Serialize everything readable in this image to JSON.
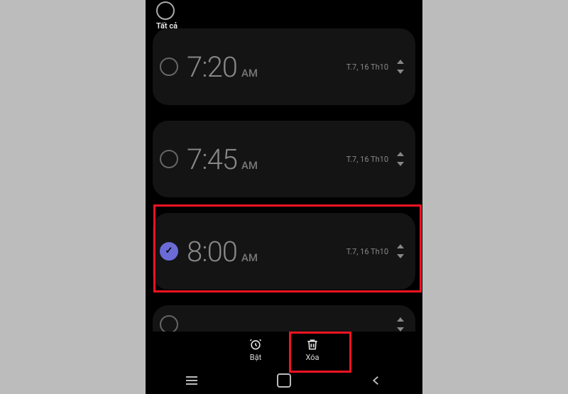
{
  "header": {
    "select_all_label": "Tất cả"
  },
  "alarms": [
    {
      "time": "7:20",
      "ampm": "AM",
      "date": "T.7, 16 Th10",
      "checked": false
    },
    {
      "time": "7:45",
      "ampm": "AM",
      "date": "T.7, 16 Th10",
      "checked": false
    },
    {
      "time": "8:00",
      "ampm": "AM",
      "date": "T.7, 16 Th10",
      "checked": true
    }
  ],
  "actions": {
    "enable_label": "Bật",
    "delete_label": "Xóa"
  },
  "colors": {
    "highlight": "#f31322",
    "accent": "#6b6bd6",
    "card": "#141414"
  }
}
